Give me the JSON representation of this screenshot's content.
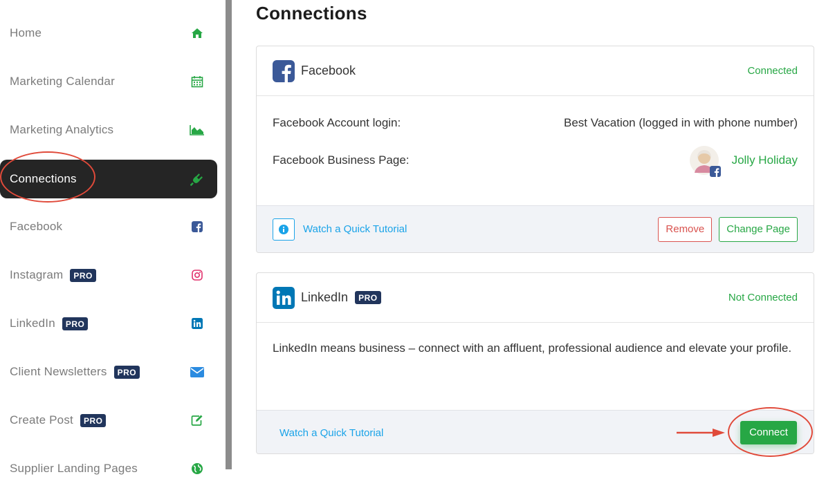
{
  "sidebar": {
    "items": [
      {
        "label": "Home",
        "pro": "",
        "icon": "home-icon",
        "active": false
      },
      {
        "label": "Marketing Calendar",
        "pro": "",
        "icon": "calendar-icon",
        "active": false
      },
      {
        "label": "Marketing Analytics",
        "pro": "",
        "icon": "area-chart-icon",
        "active": false
      },
      {
        "label": "Connections",
        "pro": "",
        "icon": "plug-icon",
        "active": true
      },
      {
        "label": "Facebook",
        "pro": "",
        "icon": "facebook-icon",
        "active": false
      },
      {
        "label": "Instagram",
        "pro": "PRO",
        "icon": "instagram-icon",
        "active": false
      },
      {
        "label": "LinkedIn",
        "pro": "PRO",
        "icon": "linkedin-icon",
        "active": false
      },
      {
        "label": "Client Newsletters",
        "pro": "PRO",
        "icon": "envelope-icon",
        "active": false
      },
      {
        "label": "Create Post",
        "pro": "PRO",
        "icon": "edit-icon",
        "active": false
      },
      {
        "label": "Supplier Landing Pages",
        "pro": "",
        "icon": "globe-icon",
        "active": false
      }
    ]
  },
  "main": {
    "title": "Connections",
    "facebook": {
      "name": "Facebook",
      "status": "Connected",
      "account_label": "Facebook Account login:",
      "account_value": "Best Vacation (logged in with phone number)",
      "page_label": "Facebook Business Page:",
      "page_value": "Jolly Holiday",
      "tutorial": "Watch a Quick Tutorial",
      "remove": "Remove",
      "change_page": "Change Page"
    },
    "linkedin": {
      "name": "LinkedIn",
      "pro": "PRO",
      "status": "Not Connected",
      "description": "LinkedIn means business – connect with an affluent, professional audience and elevate your profile.",
      "tutorial": "Watch a Quick Tutorial",
      "connect": "Connect"
    }
  },
  "colors": {
    "green": "#27a745",
    "red": "#d9534f",
    "link_blue": "#1aa3e8",
    "pro_badge": "#21355c",
    "active_bg": "#252525",
    "annotation": "#e04a3a"
  }
}
